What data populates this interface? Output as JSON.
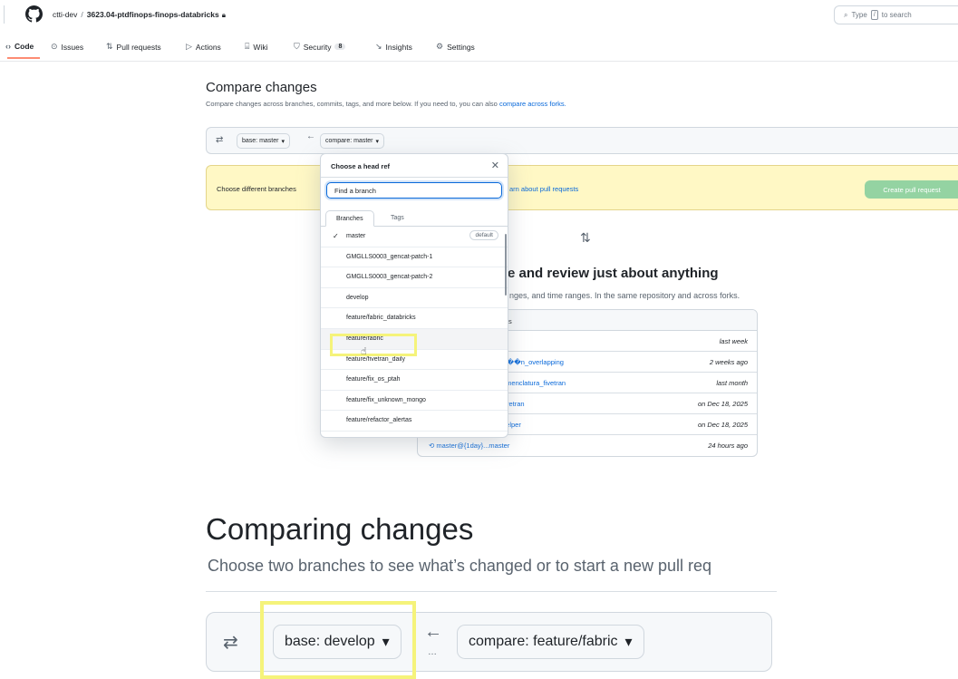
{
  "header": {
    "owner": "ctti-dev",
    "separator": "/",
    "repo": "3623.04-ptdfinops-finops-databricks",
    "search_prefix": "Type",
    "search_key": "/",
    "search_suffix": "to search"
  },
  "nav": {
    "code": "Code",
    "issues": "Issues",
    "pull_requests": "Pull requests",
    "actions": "Actions",
    "wiki": "Wiki",
    "security": "Security",
    "security_count": "8",
    "insights": "Insights",
    "settings": "Settings"
  },
  "compare": {
    "title": "Compare changes",
    "subtitle": "Compare changes across branches, commits, tags, and more below. If you need to, you can also",
    "subtitle_link": "compare across forks.",
    "base_label": "base: master",
    "compare_label": "compare: master",
    "flash_text": "Choose different branches",
    "flash_link": "arn about pull requests",
    "create_pr": "Create pull request"
  },
  "blankslate": {
    "title": "e and review just about anything",
    "subtitle": "nges, and time ranges. In the same repository and across forks."
  },
  "examples": {
    "header": "s",
    "rows": [
      {
        "link": "",
        "when": "last week"
      },
      {
        "link": "ci��n_overlapping",
        "when": "2 weeks ago"
      },
      {
        "link": "omenclatura_fivetran",
        "when": "last month"
      },
      {
        "link": "fivetran",
        "when": "on Dec 18, 2025"
      },
      {
        "link": "helper",
        "when": "on Dec 18, 2025"
      },
      {
        "link": "master@{1day}...master",
        "when": "24 hours ago"
      }
    ]
  },
  "dropdown": {
    "title": "Choose a head ref",
    "filter_placeholder": "Find a branch",
    "tab_branches": "Branches",
    "tab_tags": "Tags",
    "default_badge": "default",
    "items": [
      "master",
      "GMGLLS0003_gencat-patch-1",
      "GMGLLS0003_gencat-patch-2",
      "develop",
      "feature/fabric_databricks",
      "feature/fabric",
      "feature/fivetran_daily",
      "feature/fix_os_ptah",
      "feature/fix_unknown_mongo",
      "feature/refactor_alertas"
    ]
  },
  "zoom": {
    "title": "Comparing changes",
    "subtitle": "Choose two branches to see what’s changed or to start a new pull req",
    "base_label": "base: develop",
    "compare_label": "compare: feature/fabric"
  },
  "colors": {
    "link": "#0969da",
    "highlight": "#f5f37a",
    "flash_bg": "#fff8c5",
    "create_pr_bg": "#94d3a2",
    "nav_underline": "#fd8c73"
  }
}
